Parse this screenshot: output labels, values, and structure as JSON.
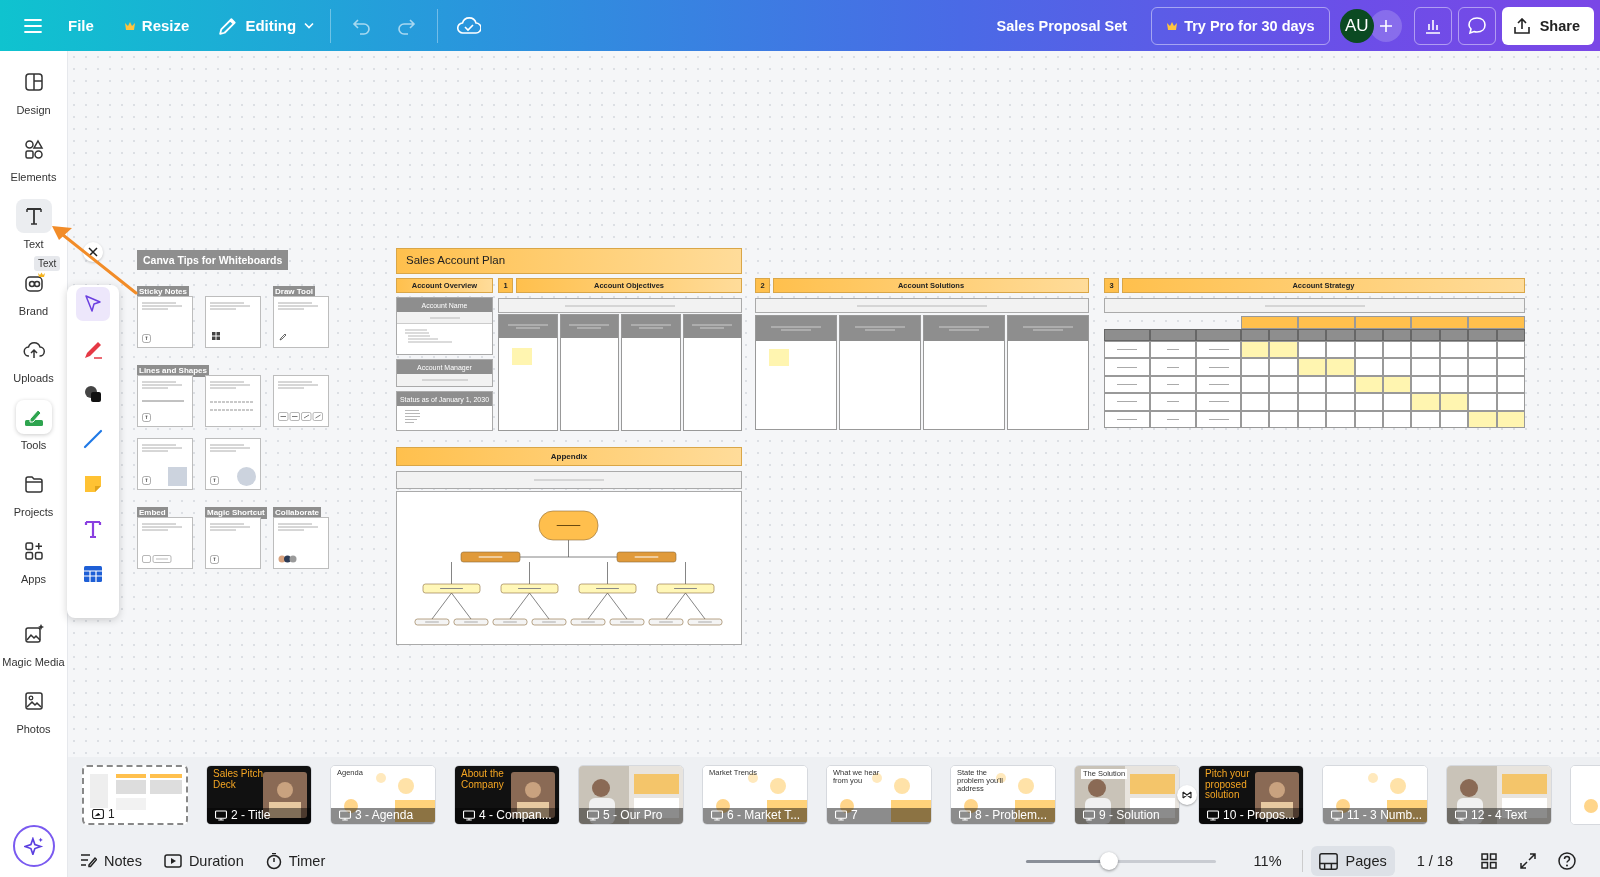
{
  "topbar": {
    "menu": "File",
    "resize": "Resize",
    "mode": "Editing",
    "title": "Sales Proposal Set",
    "pro_button": "Try Pro for 30 days",
    "avatar": "AU",
    "share": "Share"
  },
  "sidebar": {
    "tooltip": "Text",
    "items": [
      {
        "kind": "design",
        "label": "Design",
        "selected": false,
        "hovered": false
      },
      {
        "kind": "elements",
        "label": "Elements",
        "selected": false,
        "hovered": false
      },
      {
        "kind": "text",
        "label": "Text",
        "selected": false,
        "hovered": true
      },
      {
        "kind": "brand",
        "label": "Brand",
        "selected": false,
        "hovered": false
      },
      {
        "kind": "uploads",
        "label": "Uploads",
        "selected": false,
        "hovered": false
      },
      {
        "kind": "tools",
        "label": "Tools",
        "selected": true,
        "hovered": false
      },
      {
        "kind": "projects",
        "label": "Projects",
        "selected": false,
        "hovered": false
      },
      {
        "kind": "apps",
        "label": "Apps",
        "selected": false,
        "hovered": false
      },
      {
        "kind": "magic",
        "label": "Magic Media",
        "selected": false,
        "hovered": false
      },
      {
        "kind": "photos",
        "label": "Photos",
        "selected": false,
        "hovered": false
      }
    ]
  },
  "tools_panel": {
    "items": [
      {
        "kind": "select",
        "selected": true
      },
      {
        "kind": "pen",
        "selected": false
      },
      {
        "kind": "shapes",
        "selected": false
      },
      {
        "kind": "line",
        "selected": false
      },
      {
        "kind": "sticky",
        "selected": false
      },
      {
        "kind": "text",
        "selected": false
      },
      {
        "kind": "table",
        "selected": false
      }
    ]
  },
  "tips_board": {
    "title": "Canva Tips for Whiteboards",
    "rows": [
      {
        "cells": [
          {
            "label": "Sticky Notes",
            "kind": "key"
          },
          {
            "kind": "icon"
          },
          {
            "label": "Draw Tool",
            "kind": "draw"
          }
        ]
      },
      {
        "cells": [
          {
            "label": "Lines and Shapes",
            "kind": "line"
          },
          {
            "kind": "lines"
          },
          {
            "kind": "buttons"
          }
        ]
      },
      {
        "cells": [
          {
            "kind": "square"
          },
          {
            "kind": "circle"
          }
        ]
      },
      {
        "cells": [
          {
            "label": "Embed",
            "kind": "embed"
          },
          {
            "label": "Magic Shortcut",
            "kind": "key"
          },
          {
            "label": "Collaborate",
            "kind": "avatars"
          }
        ]
      }
    ]
  },
  "account_plan": {
    "title": "Sales Account Plan",
    "overview": {
      "header": "Account Overview",
      "name_header": "Account Name",
      "manager_header": "Account Manager",
      "status_header": "Status as of January 1, 2030"
    },
    "objectives": {
      "number": "1",
      "header": "Account Objectives",
      "columns": [
        {
          "sticky": true
        },
        {
          "sticky": false
        },
        {
          "sticky": false
        },
        {
          "sticky": false
        }
      ]
    },
    "solutions": {
      "number": "2",
      "header": "Account Solutions",
      "columns": [
        {
          "sticky": true
        },
        {
          "sticky": false
        },
        {
          "sticky": false
        },
        {
          "sticky": false
        }
      ]
    },
    "strategy": {
      "number": "3",
      "header": "Account Strategy",
      "rows": [
        {
          "highlighted": [
            true,
            true,
            false,
            false,
            false,
            false,
            false,
            false,
            false,
            false
          ]
        },
        {
          "highlighted": [
            false,
            false,
            true,
            true,
            false,
            false,
            false,
            false,
            false,
            false
          ]
        },
        {
          "highlighted": [
            false,
            false,
            false,
            false,
            true,
            true,
            false,
            false,
            false,
            false
          ]
        },
        {
          "highlighted": [
            false,
            false,
            false,
            false,
            false,
            false,
            true,
            true,
            false,
            false
          ]
        },
        {
          "highlighted": [
            false,
            false,
            false,
            false,
            false,
            false,
            false,
            false,
            true,
            true
          ]
        }
      ]
    },
    "appendix": {
      "header": "Appendix"
    }
  },
  "thumbnails": [
    {
      "label": "1",
      "kind": "whiteboard",
      "selected": true
    },
    {
      "label": "2 - Title",
      "kind": "dark",
      "title": "Sales Pitch Deck",
      "selected": false
    },
    {
      "label": "3 - Agenda",
      "kind": "light",
      "title": "Agenda",
      "selected": false
    },
    {
      "label": "4 - Compan...",
      "kind": "dark",
      "title": "About the Company",
      "selected": false
    },
    {
      "label": "5 - Our Pro",
      "selected": false
    },
    {
      "label": "6 - Market T...",
      "kind": "light",
      "title": "Market Trends",
      "selected": false
    },
    {
      "label": "7",
      "kind": "light",
      "title": "What we hear from you",
      "selected": false
    },
    {
      "label": "8 - Problem...",
      "kind": "light",
      "title": "State the problem you'll address",
      "selected": false
    },
    {
      "label": "9 - Solution",
      "title": "The Solution",
      "selected": false
    },
    {
      "label": "10 - Propos...",
      "kind": "dark",
      "title": "Pitch your proposed solution",
      "selected": false
    },
    {
      "label": "11 - 3 Numb...",
      "kind": "light",
      "selected": false
    },
    {
      "label": "12 - 4 Text",
      "selected": false
    },
    {
      "kind": "edge",
      "selected": false
    }
  ],
  "footer": {
    "notes": "Notes",
    "duration": "Duration",
    "timer": "Timer",
    "zoom": {
      "level": 0.4,
      "reading": "11%"
    },
    "pages": {
      "label": "Pages",
      "selected": true
    },
    "page_count": "1 / 18"
  }
}
